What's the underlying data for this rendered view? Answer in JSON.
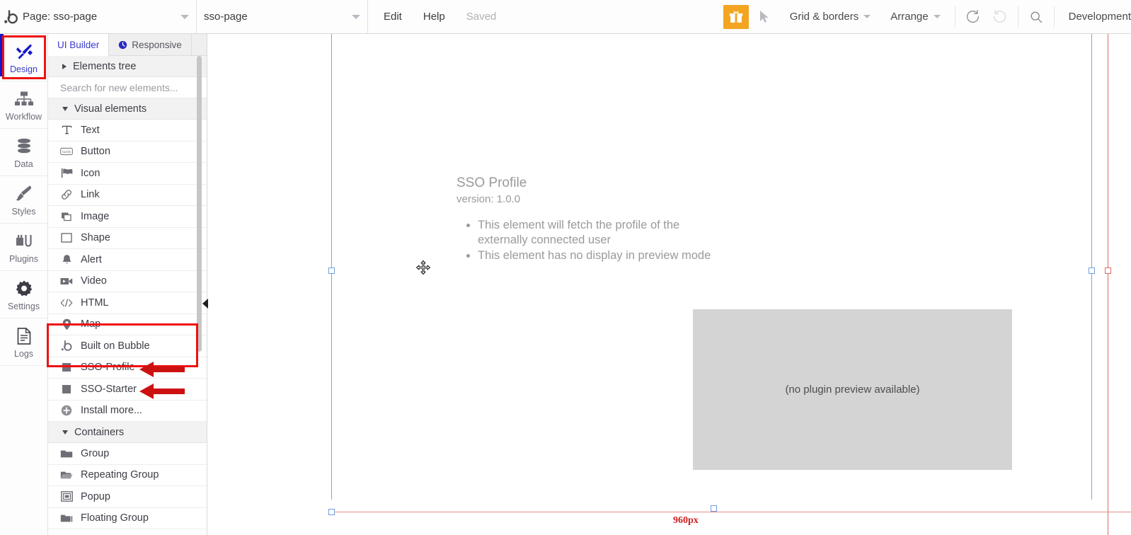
{
  "topbar": {
    "logo": "bubble-logo",
    "page_selector_label": "Page: sso-page",
    "page_name_value": "sso-page",
    "menu": [
      {
        "label": "Edit",
        "muted": false
      },
      {
        "label": "Help",
        "muted": false
      },
      {
        "label": "Saved",
        "muted": true
      }
    ],
    "gift_icon": "gift-icon",
    "pointer_icon": "cursor-arrow-icon",
    "grid_borders_label": "Grid & borders",
    "arrange_label": "Arrange",
    "undo_icon": "undo-icon",
    "redo_icon": "redo-icon",
    "search_icon": "search-icon",
    "version_label": "Development"
  },
  "rail": {
    "items": [
      {
        "label": "Design",
        "icon": "design-tools-icon",
        "active": true,
        "highlighted": true
      },
      {
        "label": "Workflow",
        "icon": "workflow-icon",
        "active": false,
        "highlighted": false
      },
      {
        "label": "Data",
        "icon": "database-icon",
        "active": false,
        "highlighted": false
      },
      {
        "label": "Styles",
        "icon": "paintbrush-icon",
        "active": false,
        "highlighted": false
      },
      {
        "label": "Plugins",
        "icon": "plug-icon",
        "active": false,
        "highlighted": false
      },
      {
        "label": "Settings",
        "icon": "gear-icon",
        "active": false,
        "highlighted": false
      },
      {
        "label": "Logs",
        "icon": "document-lines-icon",
        "active": false,
        "highlighted": false
      }
    ]
  },
  "panel": {
    "tabs": [
      {
        "label": "UI Builder",
        "icon": null,
        "active": true
      },
      {
        "label": "Responsive",
        "icon": "responsive-icon",
        "active": false
      }
    ],
    "elements_tree_label": "Elements tree",
    "search_placeholder": "Search for new elements...",
    "sections": [
      {
        "title": "Visual elements",
        "items": [
          {
            "label": "Text",
            "icon": "text-t-icon"
          },
          {
            "label": "Button",
            "icon": "button-click-icon"
          },
          {
            "label": "Icon",
            "icon": "flag-icon"
          },
          {
            "label": "Link",
            "icon": "link-chain-icon"
          },
          {
            "label": "Image",
            "icon": "image-icon"
          },
          {
            "label": "Shape",
            "icon": "square-outline-icon"
          },
          {
            "label": "Alert",
            "icon": "bell-icon"
          },
          {
            "label": "Video",
            "icon": "video-camera-icon"
          },
          {
            "label": "HTML",
            "icon": "code-tags-icon"
          },
          {
            "label": "Map",
            "icon": "map-pin-icon"
          },
          {
            "label": "Built on Bubble",
            "icon": "bubble-b-icon"
          },
          {
            "label": "SSO-Profile",
            "icon": "plugin-square-icon"
          },
          {
            "label": "SSO-Starter",
            "icon": "plugin-square-icon"
          },
          {
            "label": "Install more...",
            "icon": "plus-circle-icon"
          }
        ]
      },
      {
        "title": "Containers",
        "items": [
          {
            "label": "Group",
            "icon": "folder-icon"
          },
          {
            "label": "Repeating Group",
            "icon": "folder-open-icon"
          },
          {
            "label": "Popup",
            "icon": "popup-frame-icon"
          },
          {
            "label": "Floating Group",
            "icon": "folder-stack-icon"
          }
        ]
      }
    ],
    "callout_color": "#ee1111"
  },
  "canvas": {
    "element_title": "SSO Profile",
    "element_version": "version: 1.0.0",
    "bullets": [
      "This element will fetch the profile of the externally connected user",
      "This element has no display in preview mode"
    ],
    "preview_placeholder": "(no plugin preview available)",
    "page_width_label": "960px",
    "move_cursor_icon": "move-cursor-icon"
  }
}
